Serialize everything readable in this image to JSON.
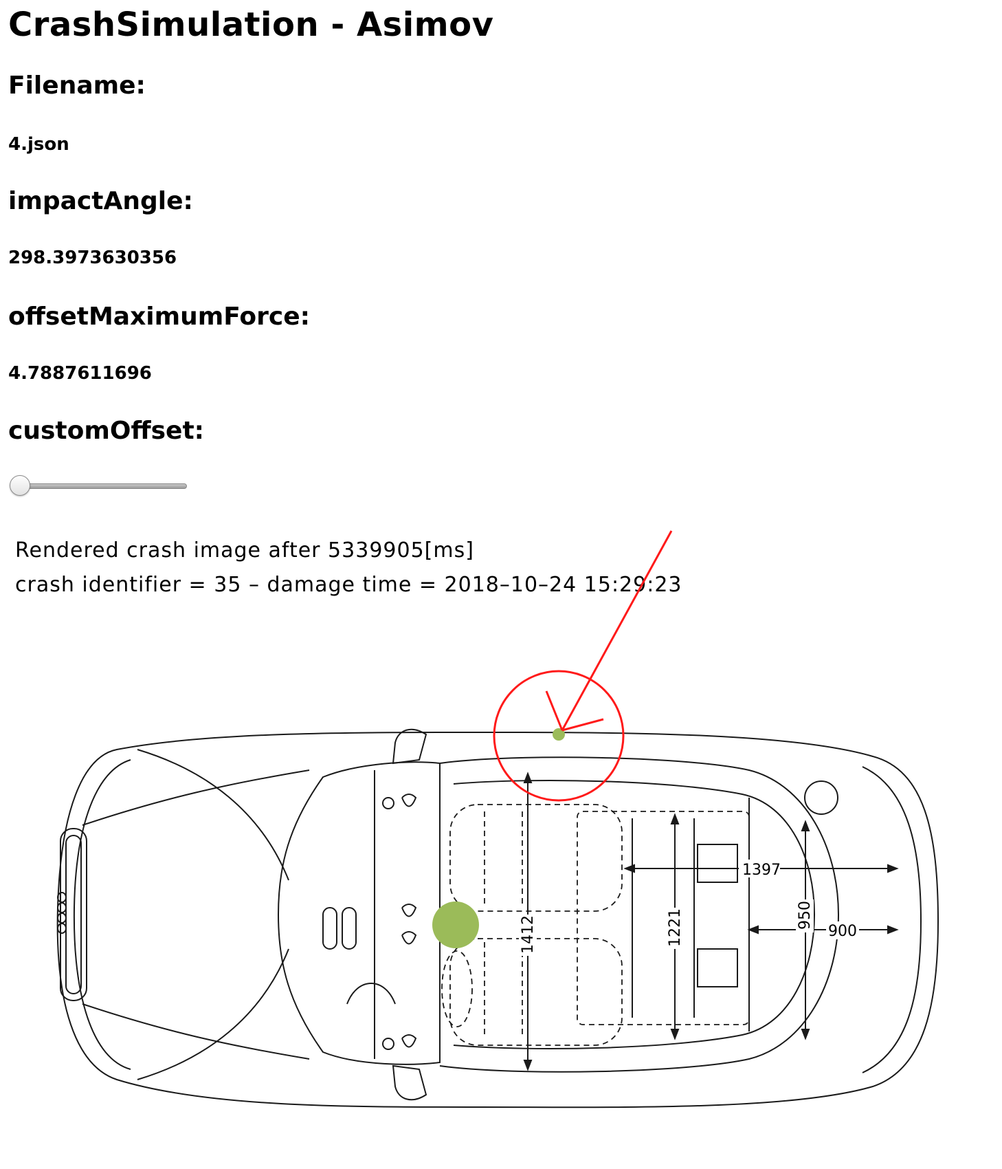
{
  "title": "CrashSimulation - Asimov",
  "fields": [
    {
      "label": "Filename:",
      "value": "4.json"
    },
    {
      "label": "impactAngle:",
      "value": "298.3973630356"
    },
    {
      "label": "offsetMaximumForce:",
      "value": "4.7887611696"
    }
  ],
  "custom_offset": {
    "label": "customOffset:",
    "value": 0
  },
  "crash_image": {
    "caption_line1": "Rendered crash image after 5339905[ms]",
    "caption_line2": "crash identifier = 35 – damage time = 2018–10–24 15:29:23",
    "dimensions": {
      "d1397": "1397",
      "d950": "950",
      "d900": "900",
      "d1412": "1412",
      "d1221": "1221"
    },
    "colors": {
      "impact_marker": "#9bbb59",
      "impact_arrow": "#ff1a1a",
      "drawing_line": "#1a1a1a"
    }
  }
}
